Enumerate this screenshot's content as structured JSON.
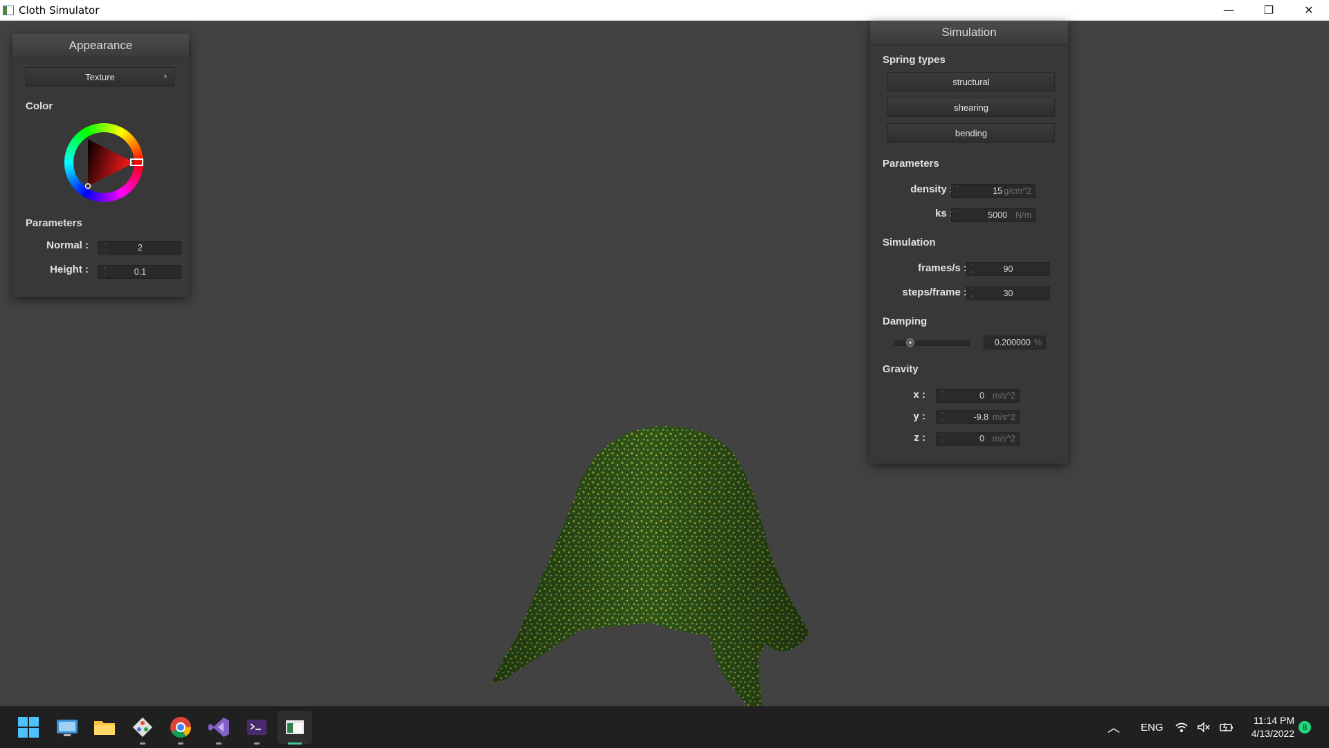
{
  "window": {
    "title": "Cloth Simulator",
    "minimize": "—",
    "restore": "❐",
    "close": "✕"
  },
  "appearance": {
    "header": "Appearance",
    "texture_button": "Texture",
    "texture_chevron": "›",
    "color_title": "Color",
    "params_title": "Parameters",
    "normal": {
      "label": "Normal :",
      "value": "2"
    },
    "height": {
      "label": "Height :",
      "value": "0.1"
    }
  },
  "simulation": {
    "header": "Simulation",
    "spring_types_title": "Spring types",
    "spring_buttons": [
      "structural",
      "shearing",
      "bending"
    ],
    "params_title": "Parameters",
    "density": {
      "label": "density :",
      "value": "15",
      "unit": "g/cm^2"
    },
    "ks": {
      "label": "ks :",
      "value": "5000",
      "unit": "N/m"
    },
    "sim_title": "Simulation",
    "fps": {
      "label": "frames/s :",
      "value": "90"
    },
    "steps": {
      "label": "steps/frame :",
      "value": "30"
    },
    "damping_title": "Damping",
    "damping": {
      "value": "0.200000",
      "unit": "%",
      "level": 0.2
    },
    "gravity_title": "Gravity",
    "gx": {
      "label": "x :",
      "value": "0",
      "unit": "m/s^2"
    },
    "gy": {
      "label": "y :",
      "value": "-9.8",
      "unit": "m/s^2"
    },
    "gz": {
      "label": "z :",
      "value": "0",
      "unit": "m/s^2"
    }
  },
  "taskbar": {
    "apps": [
      "start-icon",
      "remote-desktop-icon",
      "file-explorer-icon",
      "git-icon",
      "chrome-icon",
      "visual-studio-icon",
      "terminal-icon",
      "cloth-simulator-icon"
    ],
    "language": "ENG",
    "time": "11:14 PM",
    "date": "4/13/2022",
    "notification_count": "8"
  },
  "colors": {
    "panel_bg": "#383838",
    "viewport_bg": "#424242",
    "cloth_green": "#3f6a1e",
    "taskbar_bg": "#202020"
  }
}
